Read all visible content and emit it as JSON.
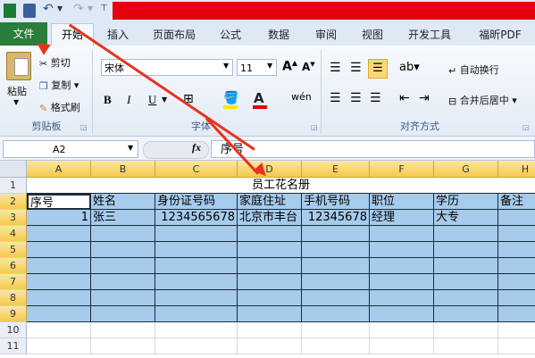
{
  "quick_access": {
    "save_icon": "save-icon",
    "undo_icon": "undo-icon",
    "redo_icon": "redo-icon"
  },
  "tabs": [
    "文件",
    "开始",
    "插入",
    "页面布局",
    "公式",
    "数据",
    "审阅",
    "视图",
    "开发工具",
    "福昕PDF"
  ],
  "ribbon": {
    "clipboard": {
      "paste": "粘贴",
      "cut": "剪切",
      "copy": "复制",
      "format_painter": "格式刷",
      "label": "剪贴板"
    },
    "font": {
      "name": "宋体",
      "size": "11",
      "bold": "B",
      "italic": "I",
      "underline": "U",
      "label": "字体"
    },
    "alignment": {
      "wrap": "自动换行",
      "merge": "合并后居中",
      "label": "对齐方式"
    }
  },
  "formula_bar": {
    "name_box": "A2",
    "fx": "fx",
    "content": "序号"
  },
  "columns": [
    "A",
    "B",
    "C",
    "D",
    "E",
    "F",
    "G",
    "H"
  ],
  "rows": [
    "1",
    "2",
    "3",
    "4",
    "5",
    "6",
    "7",
    "8",
    "9",
    "10",
    "11"
  ],
  "sheet": {
    "title": "员工花名册",
    "headers": [
      "序号",
      "姓名",
      "身份证号码",
      "家庭住址",
      "手机号码",
      "职位",
      "学历",
      "备注"
    ],
    "row3": [
      "1",
      "张三",
      "1234565678",
      "北京市丰台",
      "12345678",
      "经理",
      "大专",
      ""
    ]
  },
  "colors": {
    "file_tab": "#2a7d3a",
    "highlight": "#a6cbec",
    "title_bar": "#e8000f",
    "arrow": "#e8321e"
  }
}
